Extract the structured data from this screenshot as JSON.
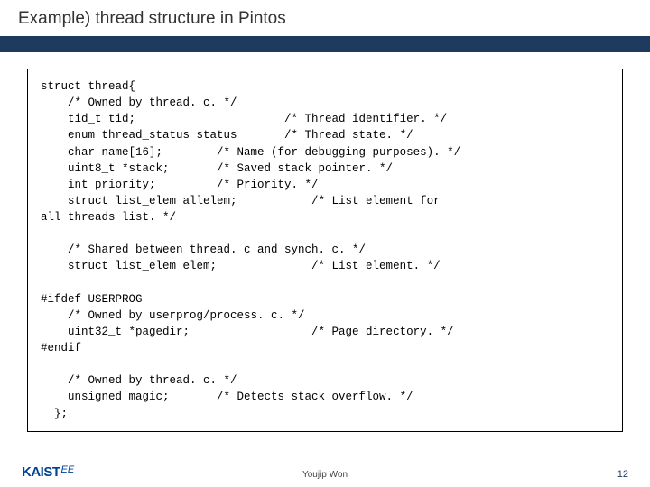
{
  "header": {
    "title": "Example) thread structure in Pintos"
  },
  "code": {
    "lines": [
      "struct thread{",
      "    /* Owned by thread. c. */",
      "    tid_t tid;                      /* Thread identifier. */",
      "    enum thread_status status       /* Thread state. */",
      "    char name[16];        /* Name (for debugging purposes). */",
      "    uint8_t *stack;       /* Saved stack pointer. */",
      "    int priority;         /* Priority. */",
      "    struct list_elem allelem;           /* List element for",
      "all threads list. */",
      "",
      "    /* Shared between thread. c and synch. c. */",
      "    struct list_elem elem;              /* List element. */",
      "",
      "#ifdef USERPROG",
      "    /* Owned by userprog/process. c. */",
      "    uint32_t *pagedir;                  /* Page directory. */",
      "#endif",
      "",
      "    /* Owned by thread. c. */",
      "    unsigned magic;       /* Detects stack overflow. */",
      "  };"
    ]
  },
  "footer": {
    "logo_main": "KAIST",
    "logo_suffix": "EE",
    "author": "Youjip Won",
    "page_number": "12"
  }
}
